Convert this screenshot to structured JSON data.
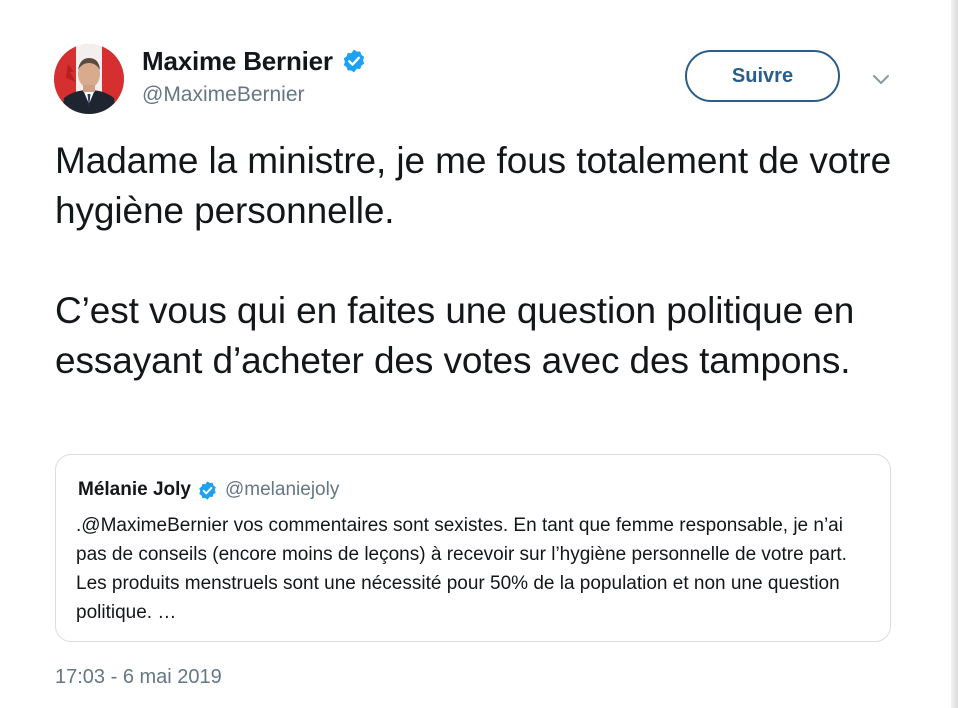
{
  "author": {
    "display_name": "Maxime Bernier",
    "handle": "@MaximeBernier",
    "verified": true
  },
  "follow_button": {
    "label": "Suivre"
  },
  "tweet": {
    "paragraphs": [
      "Madame la ministre, je me fous totalement de votre hygiène personnelle.",
      "C’est vous qui en faites une question politique en essayant d’acheter des votes avec des tampons."
    ],
    "timestamp": "17:03 - 6 mai 2019"
  },
  "quoted_tweet": {
    "display_name": "Mélanie Joly",
    "handle": "@melaniejoly",
    "verified": true,
    "text": ".@MaximeBernier vos commentaires sont sexistes. En tant que femme responsable, je n’ai pas de conseils (encore moins de leçons) à recevoir sur l’hygiène personnelle de votre part. Les produits menstruels sont une nécessité pour 50% de la population et non une question politique. …"
  },
  "icons": {
    "verified": "verified-badge-icon",
    "caret": "chevron-down-icon"
  },
  "colors": {
    "verified_blue": "#1da1f2",
    "follow_border": "#2b5d8c",
    "secondary_text": "#657786",
    "primary_text": "#14171a",
    "quote_border": "#d9dfe5"
  }
}
